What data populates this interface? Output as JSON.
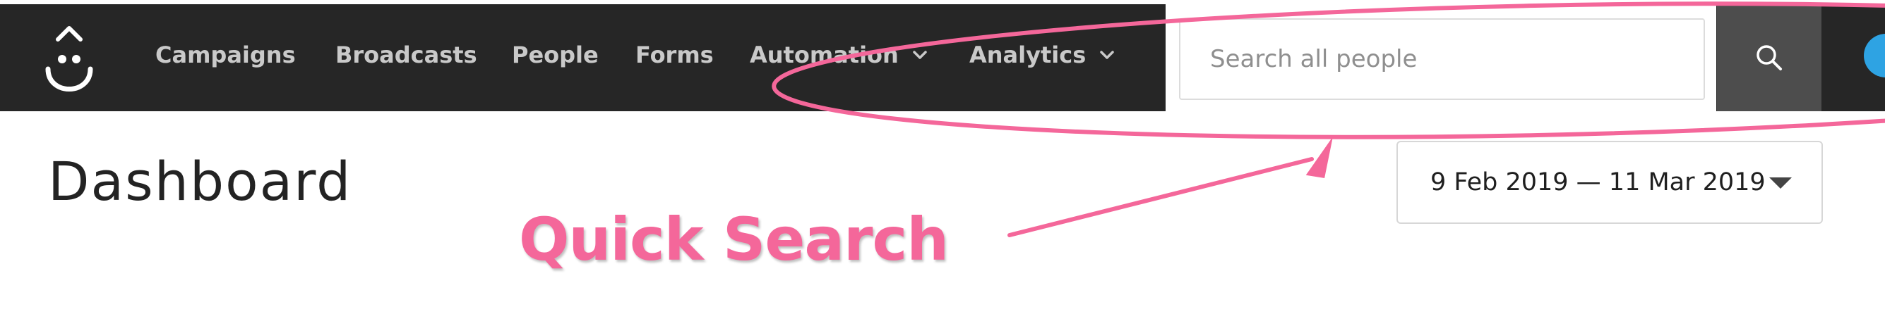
{
  "nav": {
    "items": [
      {
        "label": "Campaigns"
      },
      {
        "label": "Broadcasts"
      },
      {
        "label": "People"
      },
      {
        "label": "Forms"
      },
      {
        "label": "Automation",
        "has_dropdown": true
      },
      {
        "label": "Analytics",
        "has_dropdown": true
      }
    ]
  },
  "search": {
    "placeholder": "Search all people",
    "icon": "search-icon"
  },
  "page": {
    "title": "Dashboard"
  },
  "date_range": {
    "value": "9 Feb 2019 — 11 Mar 2019"
  },
  "annotation": {
    "label": "Quick Search",
    "color": "#f4679a"
  },
  "colors": {
    "topbar": "#262626",
    "nav_text": "#c9c9c9",
    "search_button": "#4d4d4d",
    "avatar": "#2ea3e3"
  }
}
